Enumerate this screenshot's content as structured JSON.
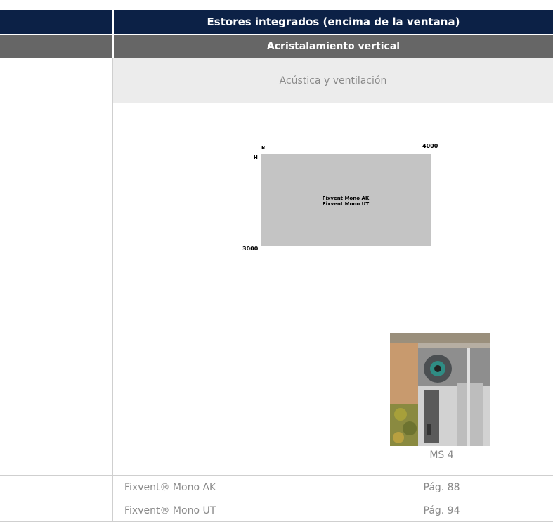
{
  "header": {
    "title": "Estores integrados (encima de la ventana)"
  },
  "subheader": {
    "title": "Acristalamiento vertical"
  },
  "category": {
    "label": "Acústica y ventilación"
  },
  "diagram": {
    "width_label": "B",
    "height_label": "H",
    "max_width": "4000",
    "max_height": "3000",
    "area_lines": [
      "Fixvent Mono AK",
      "Fixvent Mono UT"
    ],
    "fill_color": "#c4c4c4"
  },
  "product": {
    "caption": "MS 4"
  },
  "references": [
    {
      "name": "Fixvent® Mono AK",
      "page": "Pág. 88"
    },
    {
      "name": "Fixvent® Mono UT",
      "page": "Pág. 94"
    }
  ],
  "colors": {
    "header_bg": "#0c2146",
    "subheader_bg": "#666666",
    "category_bg": "#ececec"
  }
}
